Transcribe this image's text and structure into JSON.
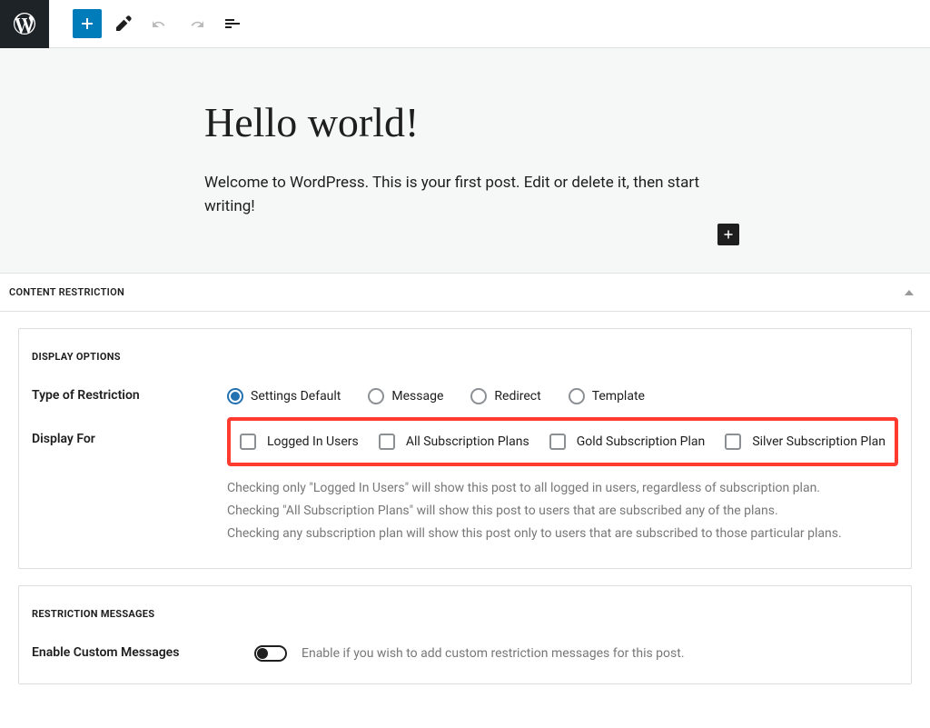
{
  "post": {
    "title": "Hello world!",
    "body": "Welcome to WordPress. This is your first post. Edit or delete it, then start writing!"
  },
  "content_restriction": {
    "panel_title": "CONTENT RESTRICTION",
    "display_options": {
      "title": "DISPLAY OPTIONS",
      "type_label": "Type of Restriction",
      "types": [
        "Settings Default",
        "Message",
        "Redirect",
        "Template"
      ],
      "type_selected": 0,
      "display_for_label": "Display For",
      "display_for_options": [
        "Logged In Users",
        "All Subscription Plans",
        "Gold Subscription Plan",
        "Silver Subscription Plan"
      ],
      "help_line1": "Checking only \"Logged In Users\" will show this post to all logged in users, regardless of subscription plan.",
      "help_line2": "Checking \"All Subscription Plans\" will show this post to users that are subscribed any of the plans.",
      "help_line3": "Checking any subscription plan will show this post only to users that are subscribed to those particular plans."
    },
    "restriction_messages": {
      "title": "RESTRICTION MESSAGES",
      "enable_label": "Enable Custom Messages",
      "enable_hint": "Enable if you wish to add custom restriction messages for this post."
    }
  }
}
